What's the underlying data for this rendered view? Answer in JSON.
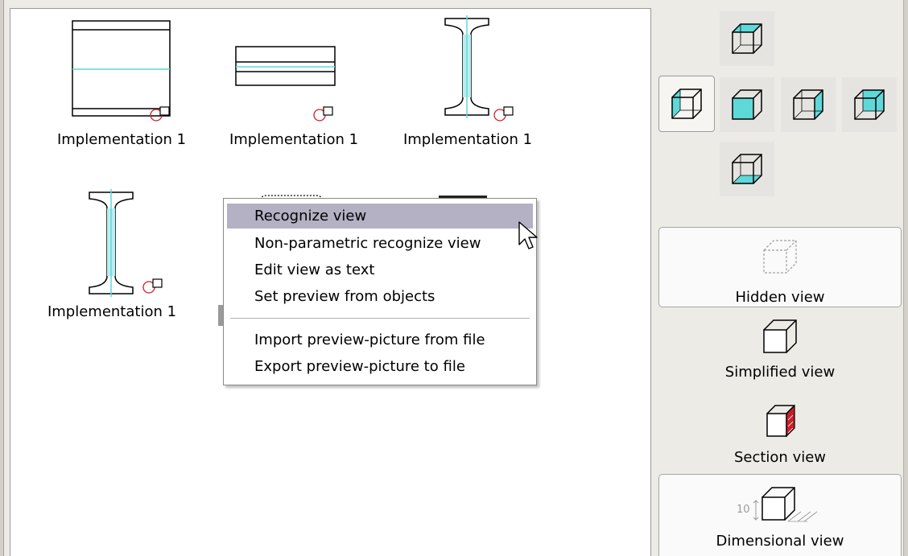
{
  "accent_color": "#5fd8d8",
  "highlight_color": "#b3b1c3",
  "section_color": "#c8202a",
  "canvas": {
    "items": [
      {
        "label": "Implementation 1",
        "shape": "rect-tall"
      },
      {
        "label": "Implementation 1",
        "shape": "rect-short"
      },
      {
        "label": "Implementation 1",
        "shape": "i-beam"
      },
      {
        "label": "Implementation 1",
        "shape": "i-beam"
      }
    ]
  },
  "context_menu": {
    "items": [
      {
        "label": "Recognize view",
        "active": true
      },
      {
        "label": "Non-parametric recognize view"
      },
      {
        "label": "Edit view as text"
      },
      {
        "label": "Set preview from objects"
      },
      {
        "label": "Import preview-picture from file"
      },
      {
        "label": "Export preview-picture to file"
      }
    ]
  },
  "view_selector": {
    "top": "top-view-icon",
    "left": "left-view-icon",
    "front": "front-view-icon",
    "right": "right-view-icon",
    "back": "back-view-icon",
    "bottom": "bottom-view-icon",
    "selected": "left"
  },
  "modes": {
    "hidden": "Hidden view",
    "simplified": "Simplified view",
    "section": "Section view",
    "dimensional": "Dimensional view",
    "dimension_value": "10"
  }
}
